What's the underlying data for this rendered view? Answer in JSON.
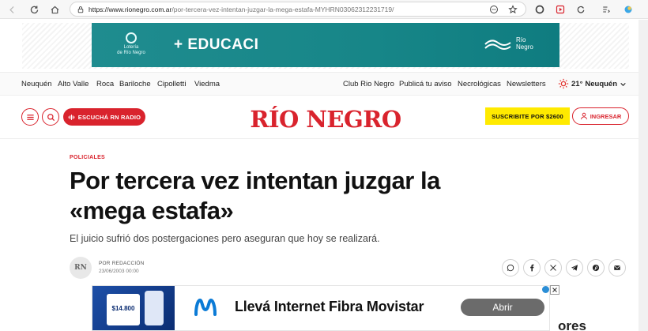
{
  "browser": {
    "url_domain": "https://www.rionegro.com.ar",
    "url_path": "/por-tercera-vez-intentan-juzgar-la-mega-estafa-MYHRN03062312231719/"
  },
  "top_ad": {
    "brand_left_line1": "Lotería",
    "brand_left_line2": "de Río Negro",
    "title": "+ EDUCACI",
    "brand_right_line1": "Río",
    "brand_right_line2": "Negro"
  },
  "topnav": {
    "left_items": [
      "Neuquén",
      "Alto Valle",
      "Roca",
      "Bariloche",
      "Cipolletti",
      "Viedma"
    ],
    "right_items": [
      "Club Rio Negro",
      "Publicá tu aviso",
      "Necrológicas",
      "Newsletters"
    ],
    "weather_temp": "21°",
    "weather_city": "Neuquén"
  },
  "header": {
    "radio_label": "ESCUCHÁ RN RADIO",
    "logo": "RÍO NEGRO",
    "subscribe_label": "SUSCRIBITE POR $2600",
    "login_label": "INGRESAR"
  },
  "article": {
    "category": "POLICIALES",
    "headline_line1": "Por tercera vez intentan juzgar la",
    "headline_line2": "«mega estafa»",
    "subhead": "El juicio sufrió dos postergaciones pero aseguran que hoy se realizará.",
    "avatar_initials": "RN",
    "author": "POR REDACCIÓN",
    "date": "23/06/2003 00:00"
  },
  "bottom_ad": {
    "thumb_price": "$14.800",
    "text": "Llevá Internet Fibra Movistar",
    "cta": "Abrir"
  },
  "side_text": "ores"
}
